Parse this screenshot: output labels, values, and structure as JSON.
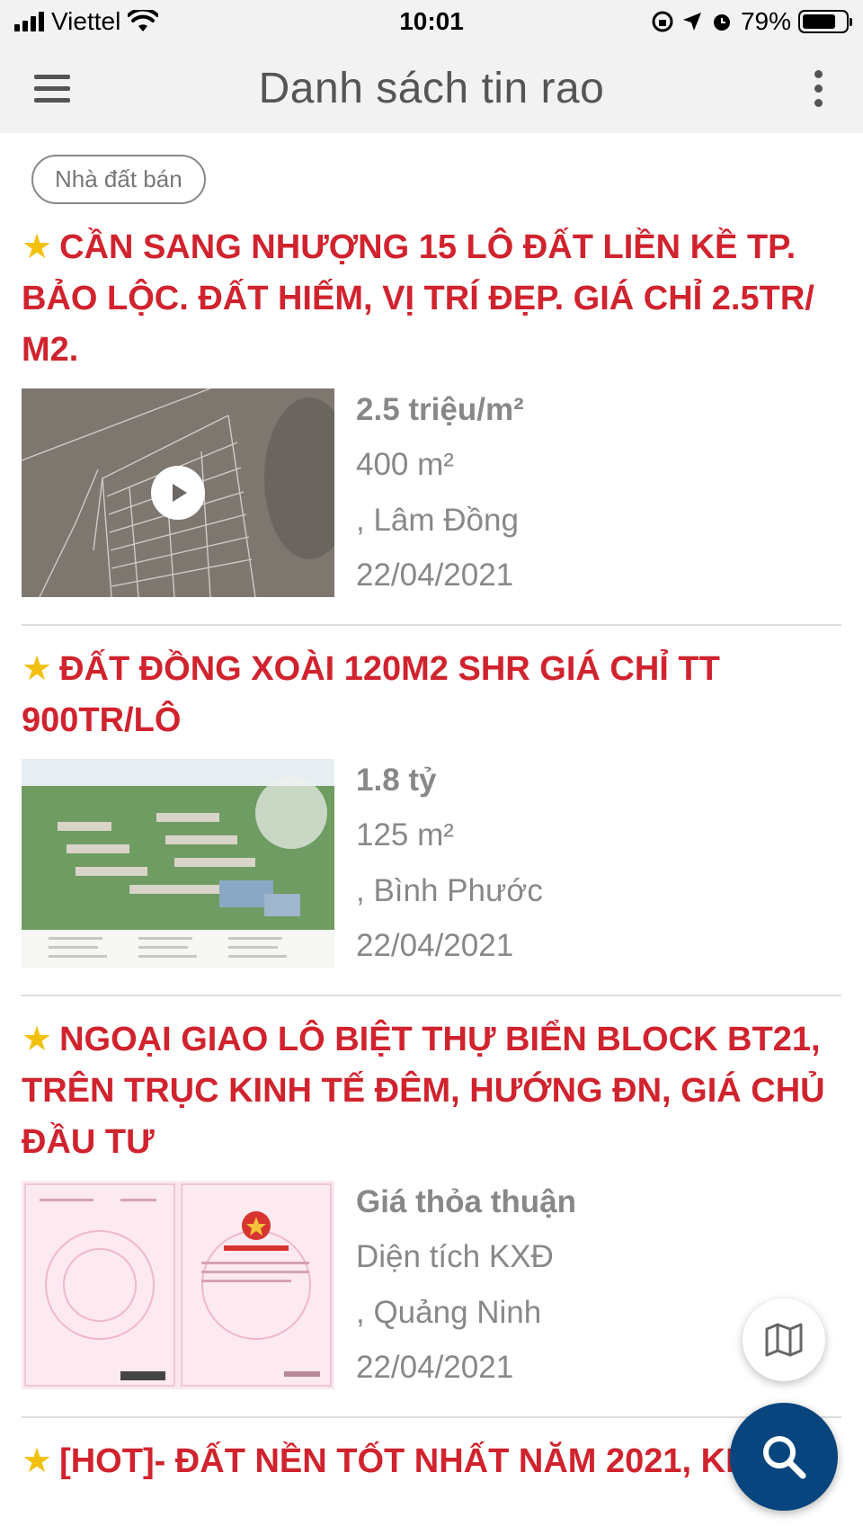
{
  "status_bar": {
    "carrier": "Viettel",
    "time": "10:01",
    "battery": "79%"
  },
  "app_bar": {
    "title": "Danh sách tin rao"
  },
  "filter_chip": "Nhà đất bán",
  "listings": [
    {
      "star": "★",
      "title": "CẦN SANG NHƯỢNG 15 LÔ ĐẤT LIỀN KỀ TP. BẢO LỘC. ĐẤT HIẾM, VỊ TRÍ ĐẸP. GIÁ CHỈ 2.5TR/ M2.",
      "price": "2.5 triệu/m²",
      "area": "400 m²",
      "location": ", Lâm Đồng",
      "date": "22/04/2021"
    },
    {
      "star": "★",
      "title": "ĐẤT ĐỒNG XOÀI 120M2 SHR GIÁ CHỈ TT 900TR/LÔ",
      "price": "1.8 tỷ",
      "area": "125 m²",
      "location": ", Bình Phước",
      "date": "22/04/2021"
    },
    {
      "star": "★",
      "title": "NGOẠI GIAO LÔ BIỆT THỰ BIỂN BLOCK BT21, TRÊN TRỤC KINH TẾ  ĐÊM, HƯỚNG ĐN, GIÁ CHỦ ĐẦU TƯ",
      "price": "Giá thỏa thuận",
      "area": "Diện tích KXĐ",
      "location": ", Quảng Ninh",
      "date": "22/04/2021"
    },
    {
      "star": "★",
      "title": "[HOT]- ĐẤT NỀN TỐT NHẤT NĂM 2021, KHU"
    }
  ],
  "colors": {
    "title_red": "#d0232e",
    "star_yellow": "#f2c110",
    "fab_blue": "#08457e"
  },
  "icons": [
    "menu-icon",
    "more-vertical-icon",
    "play-icon",
    "map-icon",
    "search-icon"
  ]
}
